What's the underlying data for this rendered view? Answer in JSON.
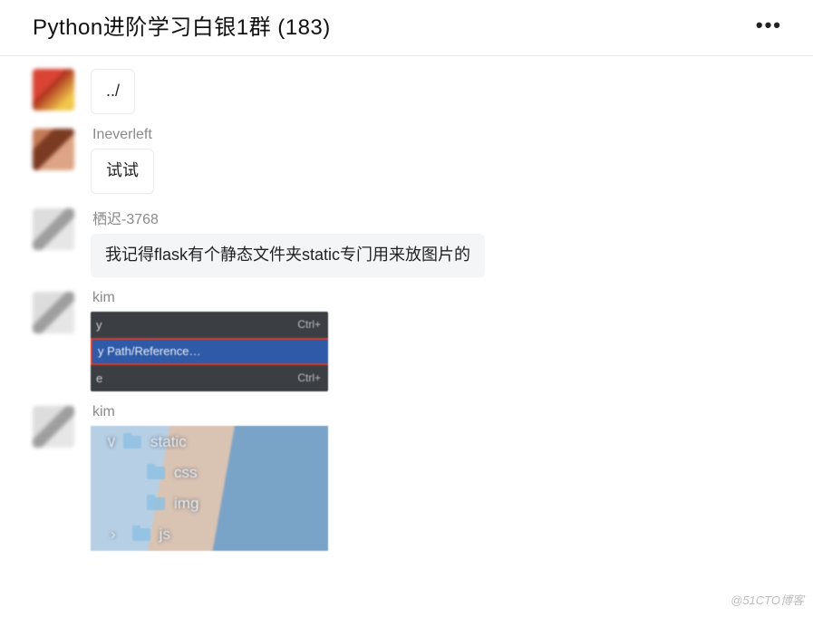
{
  "header": {
    "title": "Python进阶学习白银1群 (183)",
    "more_icon": "•••"
  },
  "messages": [
    {
      "sender": "",
      "text": "../",
      "avatar": "red"
    },
    {
      "sender": "Ineverleft",
      "text": "试试",
      "avatar": "brown"
    },
    {
      "sender": "栖迟-3768",
      "text": "我记得flask有个静态文件夹static专门用来放图片的",
      "avatar": "grey",
      "bubble_style": "light"
    },
    {
      "sender": "kim",
      "type": "image-menu",
      "avatar": "grey",
      "menu": {
        "row1_left": "y",
        "row1_right": "Ctrl+",
        "row2_left": "y Path/Reference…",
        "row2_right": "",
        "row3_left": "e",
        "row3_right": "Ctrl+"
      }
    },
    {
      "sender": "kim",
      "type": "image-tree",
      "avatar": "grey",
      "tree": {
        "parent_icon": "∨",
        "parent_label": "static",
        "children": [
          "css",
          "img",
          "js"
        ],
        "child_prefix_icon": "›"
      }
    }
  ],
  "watermark": "@51CTO博客"
}
